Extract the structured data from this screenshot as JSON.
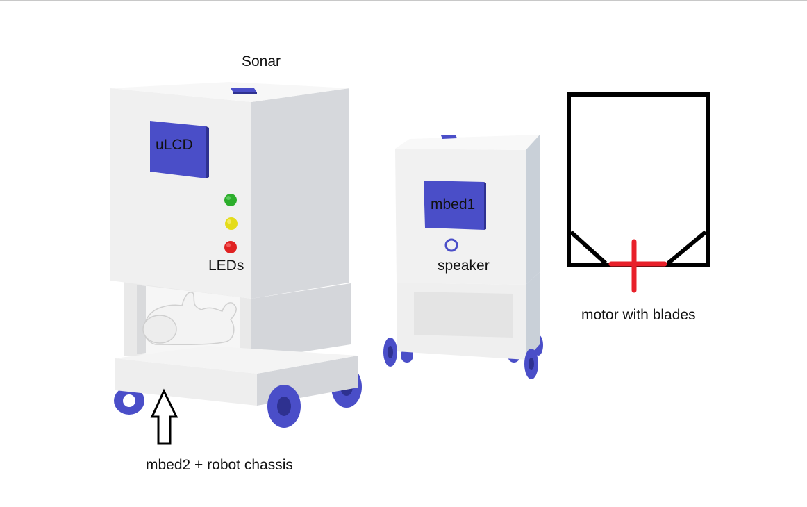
{
  "labels": {
    "sonar": "Sonar",
    "ulcd": "uLCD",
    "leds": "LEDs",
    "mbed1": "mbed1",
    "speaker": "speaker",
    "motor": "motor with blades",
    "chassis": "mbed2 + robot chassis"
  },
  "colors": {
    "module_blue": "#4a4ec8",
    "body_front": "#f0f0f0",
    "body_side": "#d6d8dc",
    "led_green": "#2cae2c",
    "led_yellow": "#e4dc1a",
    "led_red": "#e02222",
    "motor_outline": "#000000",
    "motor_blade": "#e8202a"
  }
}
